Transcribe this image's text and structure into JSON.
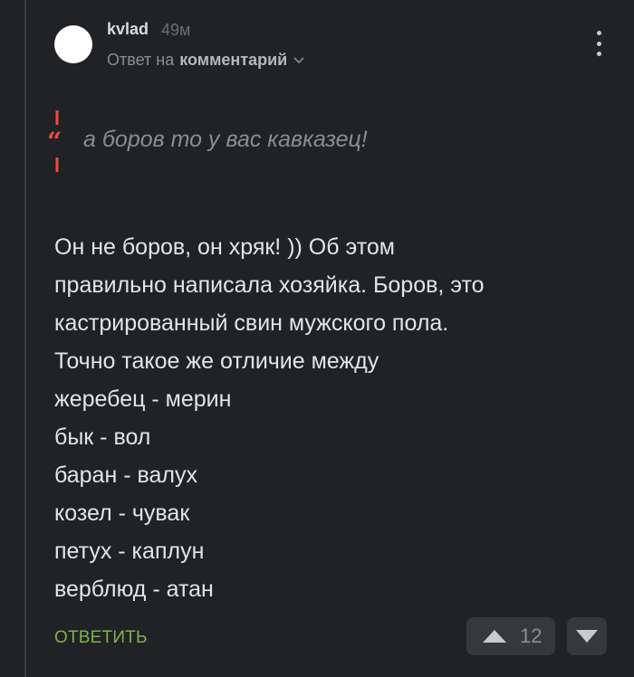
{
  "comment": {
    "author": "kvlad",
    "time": "49м",
    "reply_prefix": "Ответ на",
    "reply_target": "комментарий",
    "quote": "а боров то у вас кавказец!",
    "body_lines": [
      "Он не боров, он хряк! )) Об этом",
      "правильно написала хозяйка. Боров, это",
      "кастрированный свин мужского пола.",
      "Точно такое же отличие между",
      "жеребец - мерин",
      "бык - вол",
      "баран - валух",
      "козел - чувак",
      "петух - каплун",
      "верблюд - атан"
    ],
    "reply_button": "ОТВЕТИТЬ",
    "rating": "12"
  },
  "icons": {
    "menu": "kebab-menu-icon",
    "quote": "quote-icon",
    "chevron": "chevron-down-icon",
    "upvote": "triangle-up-icon",
    "downvote": "triangle-down-icon"
  },
  "colors": {
    "background": "#202226",
    "accent_green": "#80b14c",
    "quote_red": "#e8503a",
    "avatar": "#ffffff"
  }
}
